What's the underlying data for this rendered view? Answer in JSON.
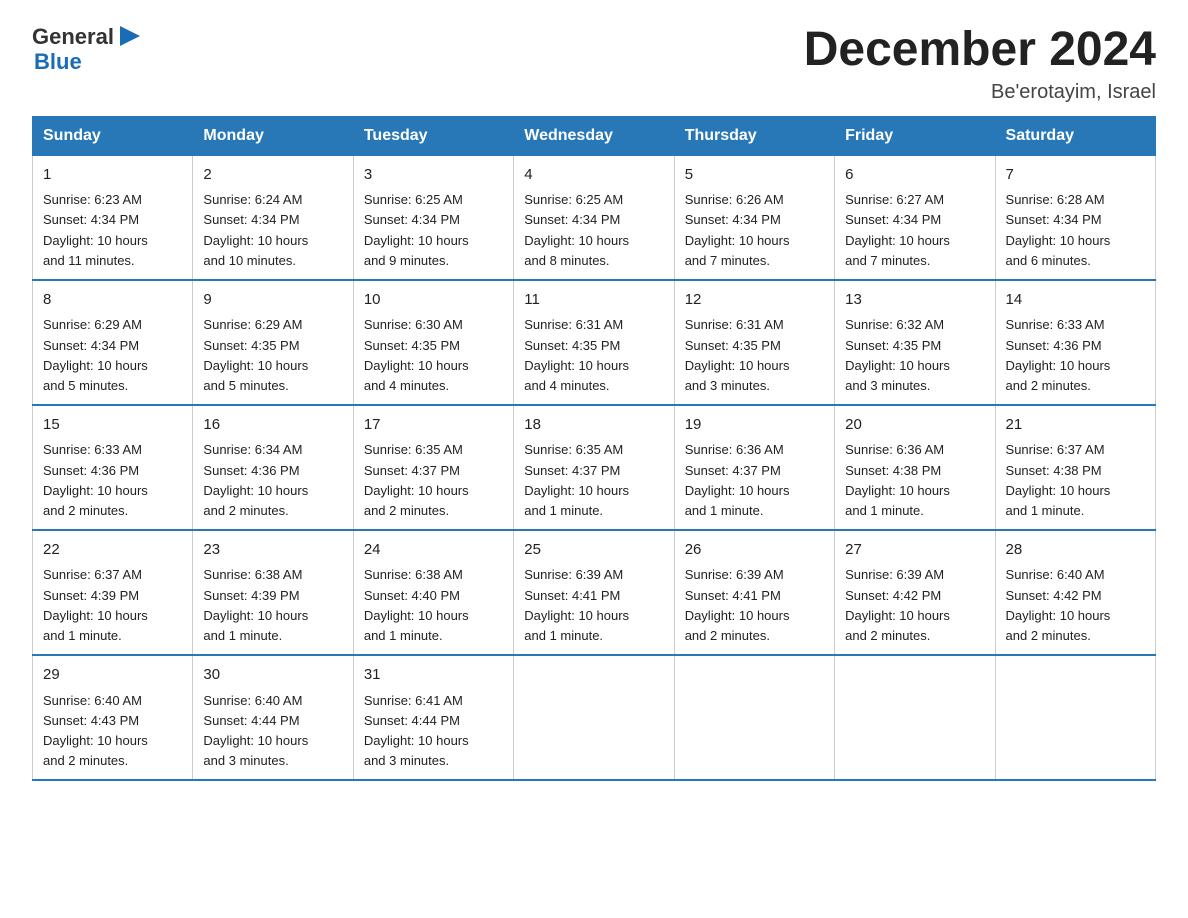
{
  "header": {
    "logo_general": "General",
    "logo_blue": "Blue",
    "month_title": "December 2024",
    "location": "Be'erotayim, Israel"
  },
  "days_of_week": [
    "Sunday",
    "Monday",
    "Tuesday",
    "Wednesday",
    "Thursday",
    "Friday",
    "Saturday"
  ],
  "weeks": [
    [
      {
        "day": "1",
        "sunrise": "6:23 AM",
        "sunset": "4:34 PM",
        "daylight": "10 hours and 11 minutes."
      },
      {
        "day": "2",
        "sunrise": "6:24 AM",
        "sunset": "4:34 PM",
        "daylight": "10 hours and 10 minutes."
      },
      {
        "day": "3",
        "sunrise": "6:25 AM",
        "sunset": "4:34 PM",
        "daylight": "10 hours and 9 minutes."
      },
      {
        "day": "4",
        "sunrise": "6:25 AM",
        "sunset": "4:34 PM",
        "daylight": "10 hours and 8 minutes."
      },
      {
        "day": "5",
        "sunrise": "6:26 AM",
        "sunset": "4:34 PM",
        "daylight": "10 hours and 7 minutes."
      },
      {
        "day": "6",
        "sunrise": "6:27 AM",
        "sunset": "4:34 PM",
        "daylight": "10 hours and 7 minutes."
      },
      {
        "day": "7",
        "sunrise": "6:28 AM",
        "sunset": "4:34 PM",
        "daylight": "10 hours and 6 minutes."
      }
    ],
    [
      {
        "day": "8",
        "sunrise": "6:29 AM",
        "sunset": "4:34 PM",
        "daylight": "10 hours and 5 minutes."
      },
      {
        "day": "9",
        "sunrise": "6:29 AM",
        "sunset": "4:35 PM",
        "daylight": "10 hours and 5 minutes."
      },
      {
        "day": "10",
        "sunrise": "6:30 AM",
        "sunset": "4:35 PM",
        "daylight": "10 hours and 4 minutes."
      },
      {
        "day": "11",
        "sunrise": "6:31 AM",
        "sunset": "4:35 PM",
        "daylight": "10 hours and 4 minutes."
      },
      {
        "day": "12",
        "sunrise": "6:31 AM",
        "sunset": "4:35 PM",
        "daylight": "10 hours and 3 minutes."
      },
      {
        "day": "13",
        "sunrise": "6:32 AM",
        "sunset": "4:35 PM",
        "daylight": "10 hours and 3 minutes."
      },
      {
        "day": "14",
        "sunrise": "6:33 AM",
        "sunset": "4:36 PM",
        "daylight": "10 hours and 2 minutes."
      }
    ],
    [
      {
        "day": "15",
        "sunrise": "6:33 AM",
        "sunset": "4:36 PM",
        "daylight": "10 hours and 2 minutes."
      },
      {
        "day": "16",
        "sunrise": "6:34 AM",
        "sunset": "4:36 PM",
        "daylight": "10 hours and 2 minutes."
      },
      {
        "day": "17",
        "sunrise": "6:35 AM",
        "sunset": "4:37 PM",
        "daylight": "10 hours and 2 minutes."
      },
      {
        "day": "18",
        "sunrise": "6:35 AM",
        "sunset": "4:37 PM",
        "daylight": "10 hours and 1 minute."
      },
      {
        "day": "19",
        "sunrise": "6:36 AM",
        "sunset": "4:37 PM",
        "daylight": "10 hours and 1 minute."
      },
      {
        "day": "20",
        "sunrise": "6:36 AM",
        "sunset": "4:38 PM",
        "daylight": "10 hours and 1 minute."
      },
      {
        "day": "21",
        "sunrise": "6:37 AM",
        "sunset": "4:38 PM",
        "daylight": "10 hours and 1 minute."
      }
    ],
    [
      {
        "day": "22",
        "sunrise": "6:37 AM",
        "sunset": "4:39 PM",
        "daylight": "10 hours and 1 minute."
      },
      {
        "day": "23",
        "sunrise": "6:38 AM",
        "sunset": "4:39 PM",
        "daylight": "10 hours and 1 minute."
      },
      {
        "day": "24",
        "sunrise": "6:38 AM",
        "sunset": "4:40 PM",
        "daylight": "10 hours and 1 minute."
      },
      {
        "day": "25",
        "sunrise": "6:39 AM",
        "sunset": "4:41 PM",
        "daylight": "10 hours and 1 minute."
      },
      {
        "day": "26",
        "sunrise": "6:39 AM",
        "sunset": "4:41 PM",
        "daylight": "10 hours and 2 minutes."
      },
      {
        "day": "27",
        "sunrise": "6:39 AM",
        "sunset": "4:42 PM",
        "daylight": "10 hours and 2 minutes."
      },
      {
        "day": "28",
        "sunrise": "6:40 AM",
        "sunset": "4:42 PM",
        "daylight": "10 hours and 2 minutes."
      }
    ],
    [
      {
        "day": "29",
        "sunrise": "6:40 AM",
        "sunset": "4:43 PM",
        "daylight": "10 hours and 2 minutes."
      },
      {
        "day": "30",
        "sunrise": "6:40 AM",
        "sunset": "4:44 PM",
        "daylight": "10 hours and 3 minutes."
      },
      {
        "day": "31",
        "sunrise": "6:41 AM",
        "sunset": "4:44 PM",
        "daylight": "10 hours and 3 minutes."
      },
      null,
      null,
      null,
      null
    ]
  ],
  "sunrise_label": "Sunrise:",
  "sunset_label": "Sunset:",
  "daylight_label": "Daylight:"
}
